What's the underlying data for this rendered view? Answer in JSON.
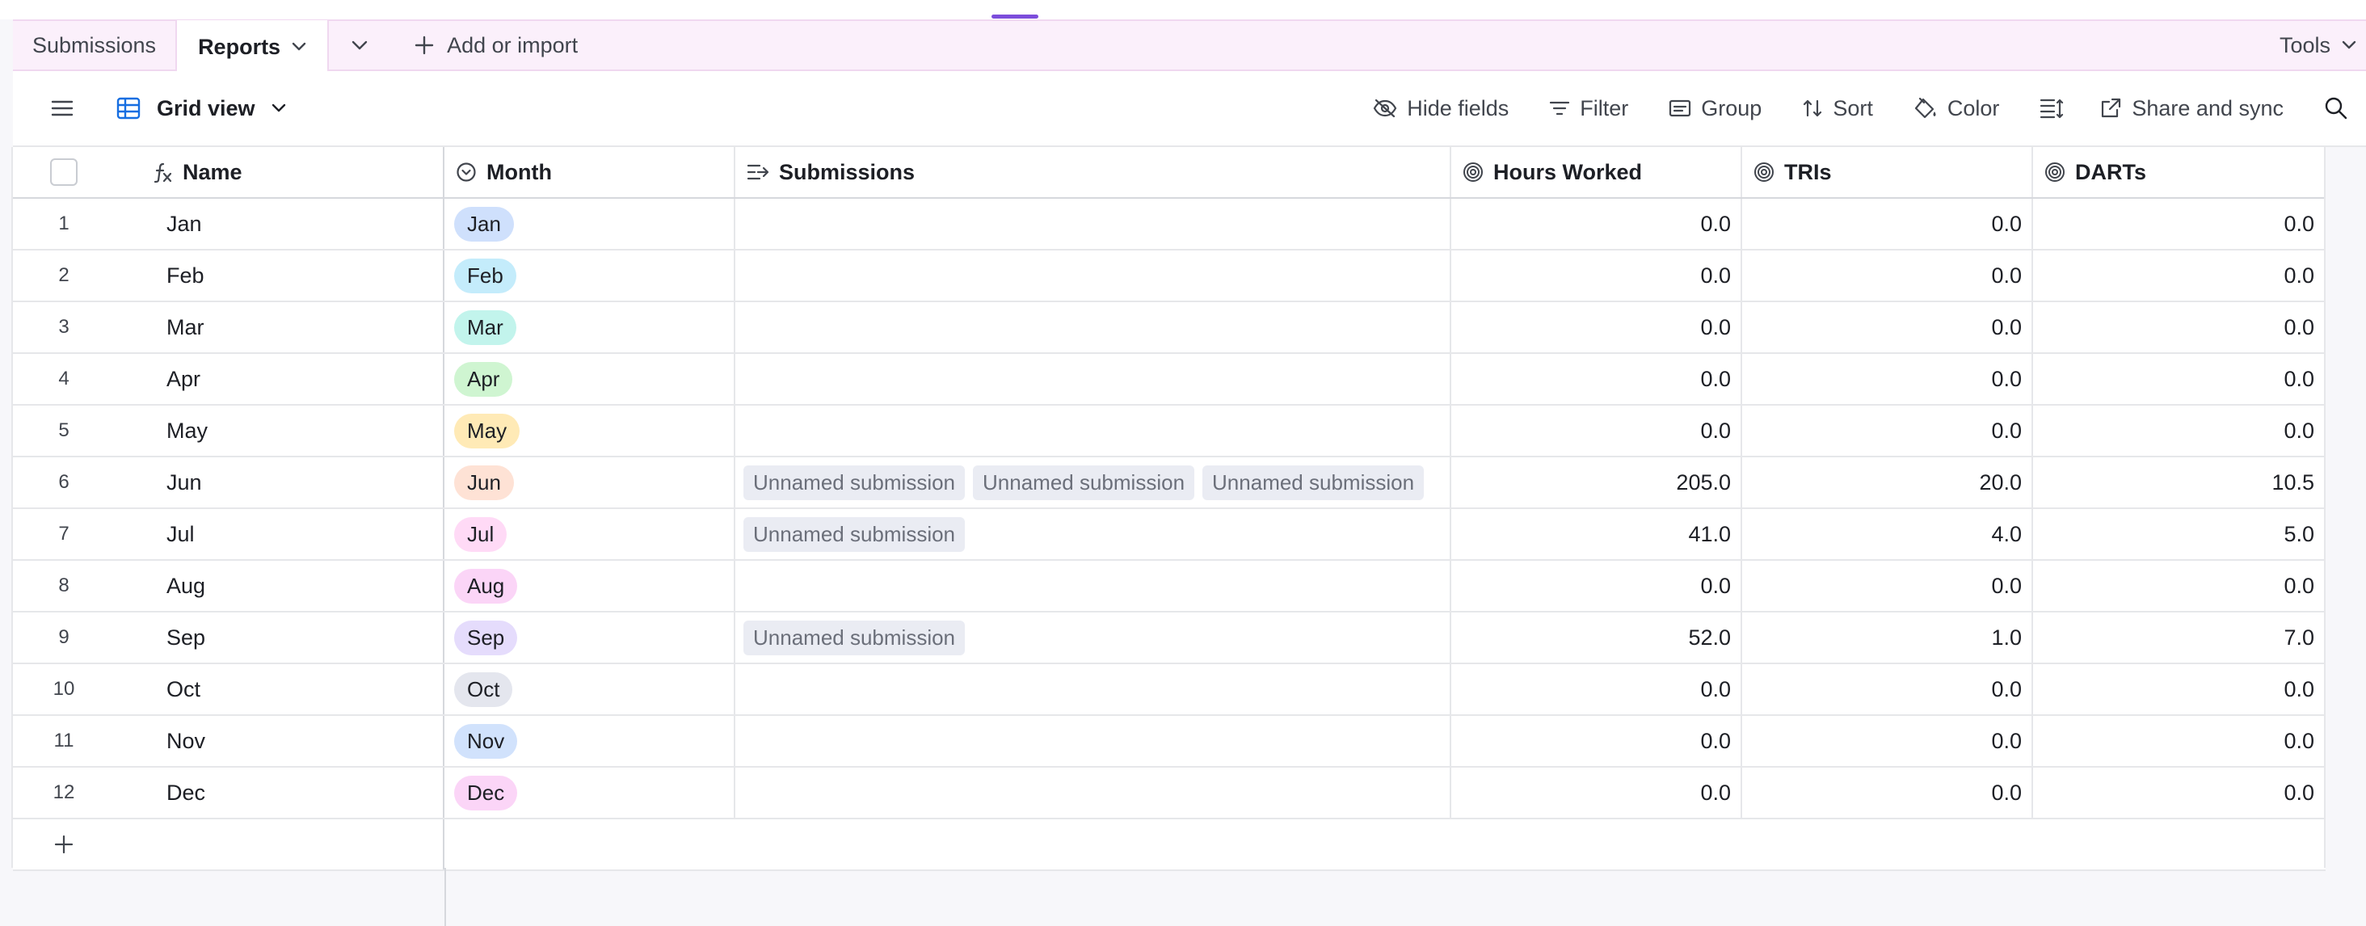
{
  "tabs": {
    "submissions": "Submissions",
    "reports": "Reports",
    "add_import": "Add or import",
    "tools": "Tools"
  },
  "toolbar": {
    "view_name": "Grid view",
    "hide_fields": "Hide fields",
    "filter": "Filter",
    "group": "Group",
    "sort": "Sort",
    "color": "Color",
    "share_sync": "Share and sync"
  },
  "columns": {
    "name": "Name",
    "month": "Month",
    "submissions": "Submissions",
    "hours": "Hours Worked",
    "tris": "TRIs",
    "darts": "DARTs"
  },
  "rows": [
    {
      "n": "1",
      "name": "Jan",
      "month": "Jan",
      "color": "#cfe0fc",
      "subs": [],
      "hours": "0.0",
      "tris": "0.0",
      "darts": "0.0"
    },
    {
      "n": "2",
      "name": "Feb",
      "month": "Feb",
      "color": "#c4ecfb",
      "subs": [],
      "hours": "0.0",
      "tris": "0.0",
      "darts": "0.0"
    },
    {
      "n": "3",
      "name": "Mar",
      "month": "Mar",
      "color": "#c2f4ec",
      "subs": [],
      "hours": "0.0",
      "tris": "0.0",
      "darts": "0.0"
    },
    {
      "n": "4",
      "name": "Apr",
      "month": "Apr",
      "color": "#cff5d1",
      "subs": [],
      "hours": "0.0",
      "tris": "0.0",
      "darts": "0.0"
    },
    {
      "n": "5",
      "name": "May",
      "month": "May",
      "color": "#ffeab6",
      "subs": [],
      "hours": "0.0",
      "tris": "0.0",
      "darts": "0.0"
    },
    {
      "n": "6",
      "name": "Jun",
      "month": "Jun",
      "color": "#fee2d5",
      "subs": [
        "Unnamed submission",
        "Unnamed submission",
        "Unnamed submission"
      ],
      "hours": "205.0",
      "tris": "20.0",
      "darts": "10.5"
    },
    {
      "n": "7",
      "name": "Jul",
      "month": "Jul",
      "color": "#ffdaf6",
      "subs": [
        "Unnamed submission"
      ],
      "hours": "41.0",
      "tris": "4.0",
      "darts": "5.0"
    },
    {
      "n": "8",
      "name": "Aug",
      "month": "Aug",
      "color": "#fbd5f7",
      "subs": [],
      "hours": "0.0",
      "tris": "0.0",
      "darts": "0.0"
    },
    {
      "n": "9",
      "name": "Sep",
      "month": "Sep",
      "color": "#e5dcfc",
      "subs": [
        "Unnamed submission"
      ],
      "hours": "52.0",
      "tris": "1.0",
      "darts": "7.0"
    },
    {
      "n": "10",
      "name": "Oct",
      "month": "Oct",
      "color": "#e4e6ee",
      "subs": [],
      "hours": "0.0",
      "tris": "0.0",
      "darts": "0.0"
    },
    {
      "n": "11",
      "name": "Nov",
      "month": "Nov",
      "color": "#d1e2fc",
      "subs": [],
      "hours": "0.0",
      "tris": "0.0",
      "darts": "0.0"
    },
    {
      "n": "12",
      "name": "Dec",
      "month": "Dec",
      "color": "#fbd5f7",
      "subs": [],
      "hours": "0.0",
      "tris": "0.0",
      "darts": "0.0"
    }
  ]
}
